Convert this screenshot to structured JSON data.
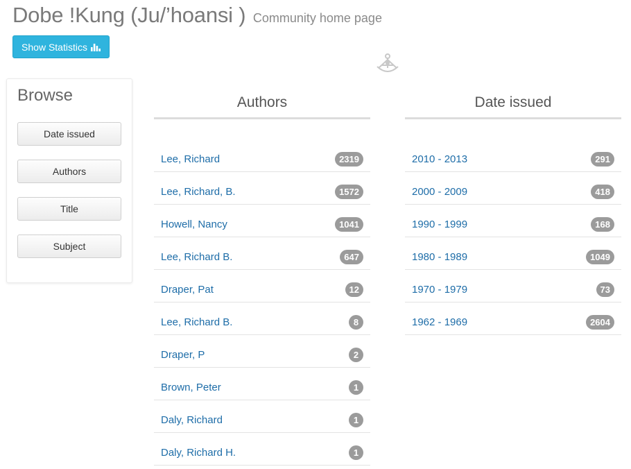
{
  "page": {
    "title": "Dobe !Kung (Ju/’hoansi )",
    "subtitle": "Community home page"
  },
  "stats_button": {
    "label": "Show Statistics",
    "icon": "bar-chart-icon"
  },
  "logo_icon": "sextant-icon",
  "browse": {
    "title": "Browse",
    "items": [
      {
        "label": "Date issued"
      },
      {
        "label": "Authors"
      },
      {
        "label": "Title"
      },
      {
        "label": "Subject"
      }
    ]
  },
  "authors": {
    "title": "Authors",
    "items": [
      {
        "name": "Lee, Richard",
        "count": "2319"
      },
      {
        "name": "Lee, Richard, B.",
        "count": "1572"
      },
      {
        "name": "Howell, Nancy",
        "count": "1041"
      },
      {
        "name": "Lee, Richard B.",
        "count": "647"
      },
      {
        "name": "Draper, Pat",
        "count": "12"
      },
      {
        "name": "Lee, Richard B.",
        "count": "8"
      },
      {
        "name": "Draper, P",
        "count": "2"
      },
      {
        "name": "Brown, Peter",
        "count": "1"
      },
      {
        "name": "Daly, Richard",
        "count": "1"
      },
      {
        "name": "Daly, Richard H.",
        "count": "1"
      }
    ]
  },
  "dates": {
    "title": "Date issued",
    "items": [
      {
        "range": "2010 - 2013",
        "count": "291"
      },
      {
        "range": "2000 - 2009",
        "count": "418"
      },
      {
        "range": "1990 - 1999",
        "count": "168"
      },
      {
        "range": "1980 - 1989",
        "count": "1049"
      },
      {
        "range": "1970 - 1979",
        "count": "73"
      },
      {
        "range": "1962 - 1969",
        "count": "2604"
      }
    ]
  },
  "colors": {
    "accent": "#2fb4de",
    "link": "#1e6da8",
    "badge": "#9b9b9b"
  }
}
